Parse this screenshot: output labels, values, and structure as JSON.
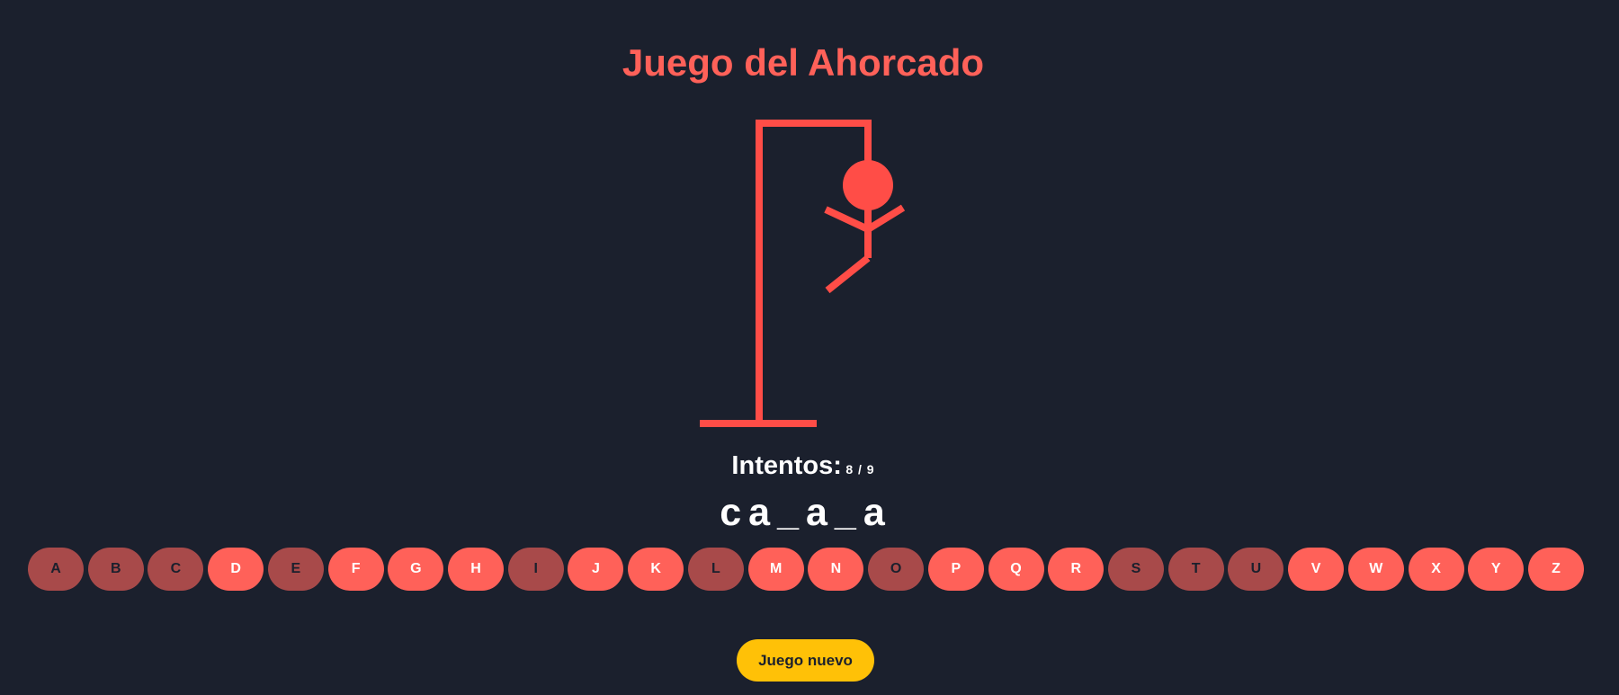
{
  "game": {
    "title": "Juego del Ahorcado",
    "attempts_label": "Intentos:",
    "attempts_count": "8 / 9",
    "attempts_used": 8,
    "attempts_max": 9,
    "word_slots": [
      "c",
      "a",
      "_",
      "a",
      "_",
      "a"
    ],
    "new_game_label": "Juego nuevo"
  },
  "keyboard": [
    {
      "letter": "A",
      "used": true
    },
    {
      "letter": "B",
      "used": true
    },
    {
      "letter": "C",
      "used": true
    },
    {
      "letter": "D",
      "used": false
    },
    {
      "letter": "E",
      "used": true
    },
    {
      "letter": "F",
      "used": false
    },
    {
      "letter": "G",
      "used": false
    },
    {
      "letter": "H",
      "used": false
    },
    {
      "letter": "I",
      "used": true
    },
    {
      "letter": "J",
      "used": false
    },
    {
      "letter": "K",
      "used": false
    },
    {
      "letter": "L",
      "used": true
    },
    {
      "letter": "M",
      "used": false
    },
    {
      "letter": "N",
      "used": false
    },
    {
      "letter": "O",
      "used": true
    },
    {
      "letter": "P",
      "used": false
    },
    {
      "letter": "Q",
      "used": false
    },
    {
      "letter": "R",
      "used": false
    },
    {
      "letter": "S",
      "used": true
    },
    {
      "letter": "T",
      "used": true
    },
    {
      "letter": "U",
      "used": true
    },
    {
      "letter": "V",
      "used": false
    },
    {
      "letter": "W",
      "used": false
    },
    {
      "letter": "X",
      "used": false
    },
    {
      "letter": "Y",
      "used": false
    },
    {
      "letter": "Z",
      "used": false
    }
  ],
  "colors": {
    "background": "#1b202d",
    "accent": "#ff6159",
    "key_used": "#a84a4a",
    "drawing": "#ff4d47",
    "new_game_button": "#ffc107"
  }
}
